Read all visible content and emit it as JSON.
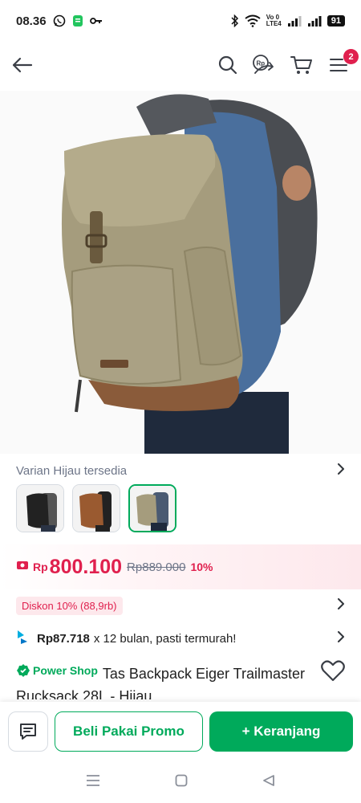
{
  "status_bar": {
    "time": "08.36",
    "battery": "91",
    "network": "Vo 0\nLTE4"
  },
  "icons": {
    "back": "arrow-left-icon",
    "search": "search-icon",
    "share": "rp-share-icon",
    "cart": "cart-icon",
    "menu": "hamburger-menu-icon",
    "heart": "heart-outline-icon",
    "chat": "chat-icon",
    "installment": "installment-logo-icon",
    "power_shop": "power-shop-icon"
  },
  "header": {
    "menu_badge": "2"
  },
  "variant": {
    "label": "Varian Hijau tersedia",
    "thumbnails": [
      "Hitam",
      "Coklat",
      "Hijau"
    ],
    "selected_index": 2
  },
  "price": {
    "currency": "Rp",
    "value": "800.100",
    "original": "Rp889.000",
    "discount_pct": "10%"
  },
  "discount": {
    "chip": "Diskon 10% (88,9rb)"
  },
  "installment": {
    "amount": "Rp87.718",
    "text": "x 12 bulan, pasti termurah!"
  },
  "product": {
    "badge": "Power Shop",
    "title": "Tas Backpack Eiger Trailmaster Rucksack 28L - Hijau"
  },
  "actions": {
    "promo_label": "Beli Pakai Promo",
    "cart_label": "+ Keranjang"
  },
  "colors": {
    "accent": "#00aa5b",
    "price_red": "#e0204e",
    "muted": "#6d7588"
  }
}
